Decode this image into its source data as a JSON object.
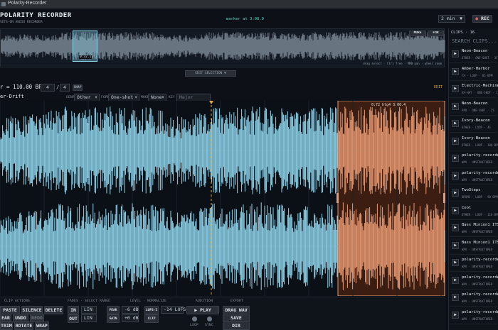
{
  "window": {
    "title": "Polarity-Recorder"
  },
  "app": {
    "title": "POLARITY RECORDER",
    "subtitle": "SETS-ON AUDIO RECORDER",
    "marker": "marker at 3:08.9",
    "duration": "2 min",
    "rec_label": "REC"
  },
  "overview": {
    "hint": "drag select · Ctrl free · MMB pan · wheel zoom",
    "marker_label": "0:32.1",
    "btn1": "MORE",
    "btn2": "FOR",
    "edit_selection": "EDIT SELECTION ▼"
  },
  "toolbar": {
    "tempo": "110.00 BPM",
    "time_sig_num": "4",
    "time_sig_den": "4",
    "snap": "SNAP",
    "genre_label": "GENRE",
    "genre": "Other",
    "form_label": "FORM",
    "form": "One-shot",
    "mood_label": "MOOD",
    "mood": "None",
    "key_label": "KEY",
    "key": "Major",
    "edit": "EDIT"
  },
  "track": {
    "name": "er-Drift",
    "selection_info": "0:72 hlg4   3:00.4"
  },
  "bottom": {
    "clip_actions": "CLIP ACTIONS",
    "paste": "PASTE",
    "silence": "SILENCE",
    "delete": "DELETE",
    "clear": "EAR",
    "undo": "UNDO",
    "redo": "REDO",
    "trim": "TRIM",
    "rotate": "ROTATE",
    "wrap": "WRAP",
    "fades": "FADES · SELECT RANGE",
    "fade_in": "IN",
    "fade_out": "OUT",
    "fade_in_val": "LIN",
    "fade_out_val": "LIN",
    "level": "LEVEL · NORMALIZE",
    "peak": "PEAK",
    "peak_val": "-6 dB",
    "gain": "GAIN",
    "gain_val": "+0 dB",
    "lufs_btn": "LUFS-I",
    "lufs_val": "-14 LUFS",
    "clip_btn": "CLIP",
    "audition": "AUDITION",
    "play": "▶ PLAY",
    "loop": "LOOP",
    "sync": "SYNC",
    "export": "EXPORT",
    "drag_wav": "DRAG WAV",
    "save": "SAVE",
    "dir": "DIR"
  },
  "clips": {
    "header": "CLIPS · 16",
    "search_placeholder": "SEARCH CLIPS...",
    "items": [
      {
        "name": "Neon-Beacon",
        "meta": "OTHER · ONE-SHOT · 3S"
      },
      {
        "name": "Amber-Harbor",
        "meta": "FX · LOOP · 85 BPM"
      },
      {
        "name": "Electric-Machine",
        "meta": "EX-HAT · ONE-SHOT · 1S"
      },
      {
        "name": "Neon-Beacon",
        "meta": "PAD · ONE-SHOT · 2S"
      },
      {
        "name": "Ivory-Beacon",
        "meta": "OTHER · LOOP · 4S"
      },
      {
        "name": "Ivory-Beacon",
        "meta": "OTHER · LOOP · 100 BPM"
      },
      {
        "name": "polarity-recorder_...",
        "meta": "WAV · UNSTRUCTURED"
      },
      {
        "name": "polarity-recorder_...",
        "meta": "WAV · UNSTRUCTURED"
      },
      {
        "name": "TwoSteps",
        "meta": "DRUMS · LOOP · 90 BPM"
      },
      {
        "name": "Cool",
        "meta": "OTHER · LOOP · 110 BPM"
      },
      {
        "name": "Bass Minion1 ITSbpm",
        "meta": "WAV · UNSTRUCTURED"
      },
      {
        "name": "Bass Minion1 ITSbpm",
        "meta": "WAV · UNSTRUCTURED"
      },
      {
        "name": "polarity-recorder_...",
        "meta": "WAV · UNSTRUCTURED"
      },
      {
        "name": "polarity-recorder_...",
        "meta": "WAV · UNSTRUCTURED"
      },
      {
        "name": "polarity-recorder_...",
        "meta": "WAV · UNSTRUCTURED"
      },
      {
        "name": "polarity-recorder_...",
        "meta": "WAV · UNSTRUCTURED"
      }
    ]
  },
  "colors": {
    "wave": "#8fd4ec",
    "selection": "#e89a72",
    "selection_bg": "#3b1d12",
    "accent": "#5fd6c5",
    "playhead": "#e3a53a"
  }
}
